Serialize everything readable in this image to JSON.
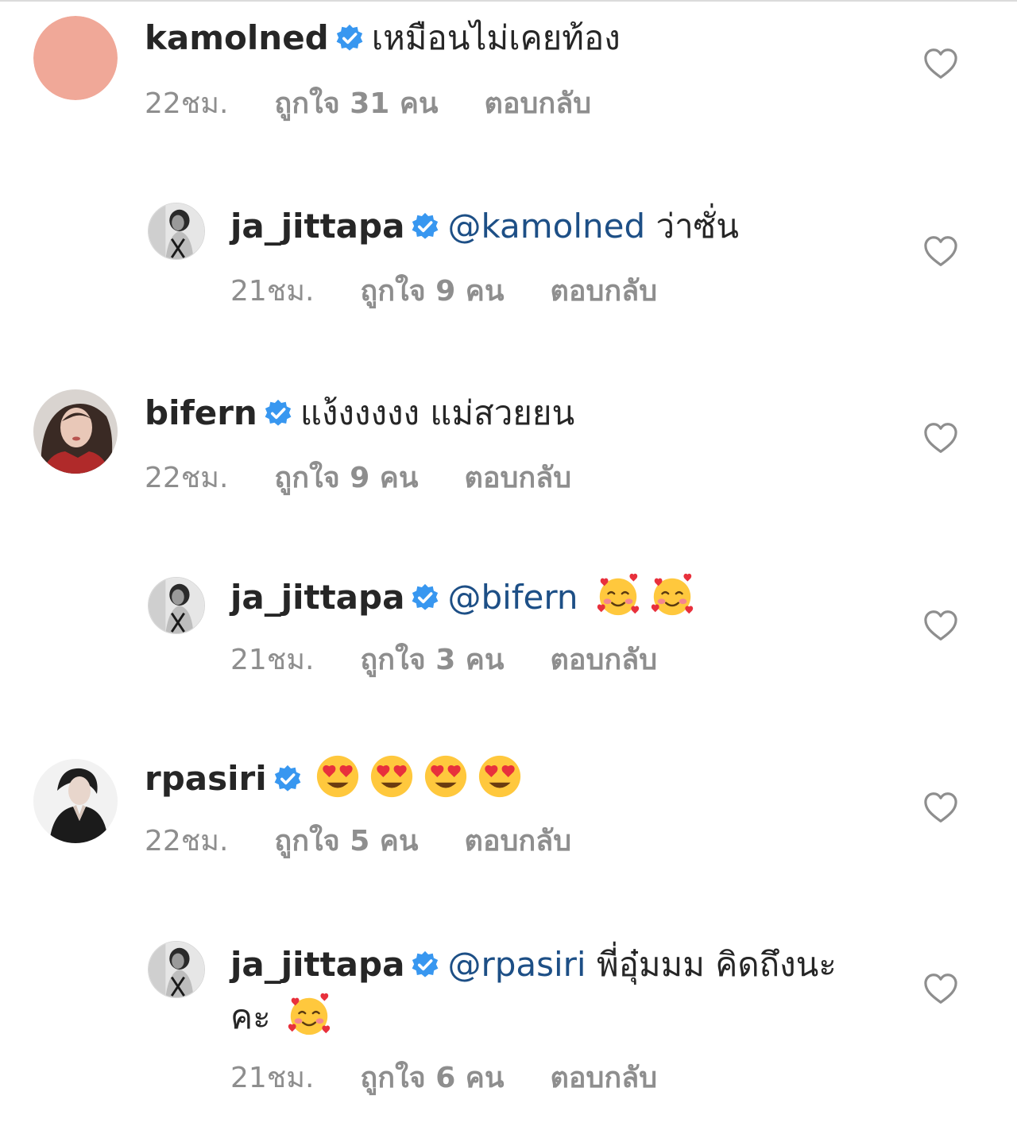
{
  "comments": [
    {
      "username": "kamolned",
      "mention": "",
      "text": "เหมือนไม่เคยท้อง",
      "continuation": "",
      "time": "22ชม.",
      "likes": "ถูกใจ 31 คน",
      "reply": "ตอบกลับ",
      "avatar": "avatar-plain-salmon",
      "emojis": []
    },
    {
      "username": "ja_jittapa",
      "mention": "@kamolned",
      "text": "ว่าซั่น",
      "continuation": "",
      "time": "21ชม.",
      "likes": "ถูกใจ 9 คน",
      "reply": "ตอบกลับ",
      "avatar": "avatar-photo-woman-bw",
      "emojis": []
    },
    {
      "username": "bifern",
      "mention": "",
      "text": "แง้งงงงง แม่สวยยน",
      "continuation": "",
      "time": "22ชม.",
      "likes": "ถูกใจ 9 คน",
      "reply": "ตอบกลับ",
      "avatar": "avatar-photo-woman-red",
      "emojis": []
    },
    {
      "username": "ja_jittapa",
      "mention": "@bifern",
      "text": "",
      "continuation": "",
      "time": "21ชม.",
      "likes": "ถูกใจ 3 คน",
      "reply": "ตอบกลับ",
      "avatar": "avatar-photo-woman-bw",
      "emojis": [
        "smiling-face-with-hearts",
        "smiling-face-with-hearts"
      ]
    },
    {
      "username": "rpasiri",
      "mention": "",
      "text": "",
      "continuation": "",
      "time": "22ชม.",
      "likes": "ถูกใจ 5 คน",
      "reply": "ตอบกลับ",
      "avatar": "avatar-photo-woman-dark",
      "emojis": [
        "heart-eyes",
        "heart-eyes",
        "heart-eyes",
        "heart-eyes"
      ]
    },
    {
      "username": "ja_jittapa",
      "mention": "@rpasiri",
      "text": "พี่อุ๋มมม คิดถึงนะ",
      "continuation": "คะ",
      "time": "21ชม.",
      "likes": "ถูกใจ 6 คน",
      "reply": "ตอบกลับ",
      "avatar": "avatar-photo-woman-bw",
      "emojis": [
        "smiling-face-with-hearts"
      ]
    }
  ],
  "icons": {
    "verified": "verified-badge-icon",
    "like": "heart-outline-icon"
  },
  "colors": {
    "verified": "#3897f0",
    "mention": "#1d4f86",
    "meta": "#8e8e8e",
    "text": "#262626",
    "avatar_plain": "#f0a898"
  }
}
